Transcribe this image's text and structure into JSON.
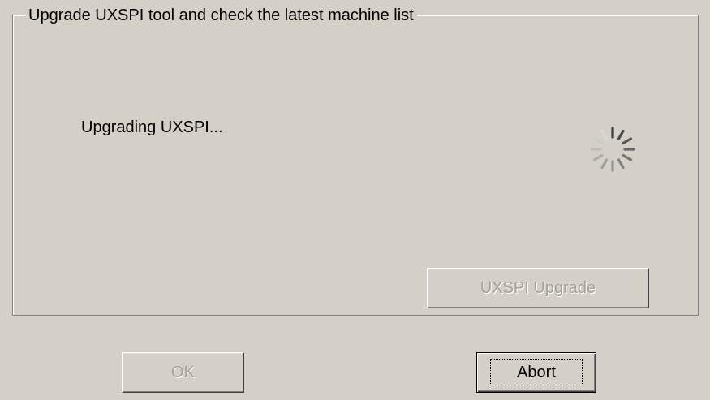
{
  "group": {
    "title": "Upgrade UXSPI tool and check the latest machine list"
  },
  "status": {
    "text": "Upgrading UXSPI..."
  },
  "spinner": {
    "icon": "loading-spinner-icon"
  },
  "buttons": {
    "upgrade_label": "UXSPI Upgrade",
    "ok_label": "OK",
    "abort_label": "Abort"
  },
  "colors": {
    "face": "#d4d0c8",
    "disabled_text": "#a3a098"
  }
}
